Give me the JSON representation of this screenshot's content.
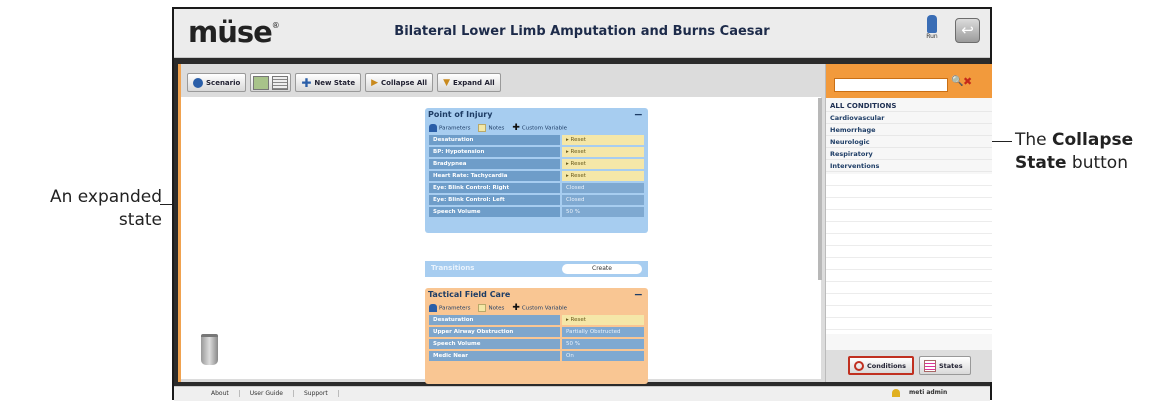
{
  "callouts": {
    "collapse": {
      "pre": "The ",
      "bold": "Collapse State",
      "post": " button",
      "line1_pre": "The ",
      "line1_bold": "Collapse",
      "line2_bold": "State",
      "line2_post": " button"
    },
    "expanded": {
      "line1": "An expanded",
      "line2": "state"
    }
  },
  "app": {
    "logo": "müse",
    "title": "Bilateral Lower Limb Amputation and Burns Caesar",
    "run_label": "Run"
  },
  "toolbar": {
    "scenario_label": "Scenario",
    "new_state_label": "New State",
    "collapse_all_label": "Collapse All",
    "expand_all_label": "Expand All"
  },
  "states": [
    {
      "title": "Point of Injury",
      "parameters_label": "Parameters",
      "notes_label": "Notes",
      "custom_variable_label": "Custom Variable",
      "rows": [
        {
          "name": "Desaturation",
          "value": "Reset"
        },
        {
          "name": "BP: Hypotension",
          "value": "Reset"
        },
        {
          "name": "Bradypnea",
          "value": "Reset"
        },
        {
          "name": "Heart Rate: Tachycardia",
          "value": "Reset"
        },
        {
          "name": "Eye: Blink Control: Right",
          "value": "Closed"
        },
        {
          "name": "Eye: Blink Control: Left",
          "value": "Closed"
        },
        {
          "name": "Speech Volume",
          "value": "50 %"
        }
      ],
      "transitions_label": "Transitions",
      "create_label": "Create"
    },
    {
      "title": "Tactical Field Care",
      "parameters_label": "Parameters",
      "notes_label": "Notes",
      "custom_variable_label": "Custom Variable",
      "rows": [
        {
          "name": "Desaturation",
          "value": "Reset"
        },
        {
          "name": "Upper Airway Obstruction",
          "value": "Partially Obstructed"
        },
        {
          "name": "Speech Volume",
          "value": "50 %"
        },
        {
          "name": "Medic Near",
          "value": "On"
        }
      ]
    }
  ],
  "conditions": {
    "header": "ALL CONDITIONS",
    "items": [
      "Cardiovascular",
      "Hemorrhage",
      "Neurologic",
      "Respiratory",
      "Interventions"
    ],
    "tab_conditions": "Conditions",
    "tab_states": "States"
  },
  "footer": {
    "links": [
      "About",
      "User Guide",
      "Support"
    ],
    "user": "meti admin"
  }
}
